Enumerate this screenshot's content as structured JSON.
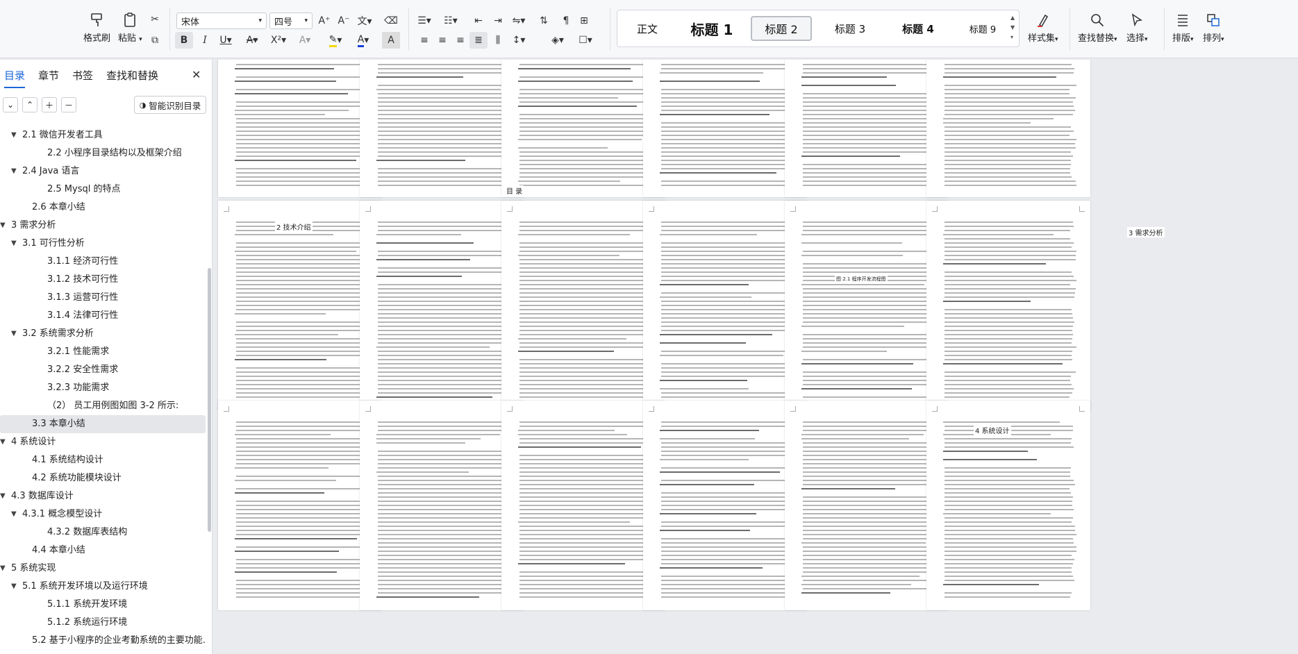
{
  "ribbon": {
    "format_painter": "格式刷",
    "paste": "粘贴",
    "font_name": "宋体",
    "font_size": "四号",
    "styles": [
      "正文",
      "标题 1",
      "标题 2",
      "标题 3",
      "标题 4",
      "标题 9"
    ],
    "style_set": "样式集",
    "find_replace": "查找替换",
    "select": "选择",
    "layout": "排版",
    "arrange": "排列"
  },
  "nav": {
    "tabs": [
      "目录",
      "章节",
      "书签",
      "查找和替换"
    ],
    "smart_toc": "智能识别目录",
    "items": [
      {
        "label": "2.1 微信开发者工具",
        "level": 2,
        "arrow": "down"
      },
      {
        "label": "2.2 小程序目录结构以及框架介绍",
        "level": 3,
        "arrow": ""
      },
      {
        "label": "2.4 Java 语言",
        "level": 2,
        "arrow": "down"
      },
      {
        "label": "2.5 Mysql 的特点",
        "level": 3,
        "arrow": ""
      },
      {
        "label": "2.6 本章小结",
        "level": 2,
        "arrow": ""
      },
      {
        "label": "3 需求分析",
        "level": 1,
        "arrow": "down"
      },
      {
        "label": "3.1 可行性分析",
        "level": 2,
        "arrow": "down"
      },
      {
        "label": "3.1.1 经济可行性",
        "level": 3,
        "arrow": ""
      },
      {
        "label": "3.1.2 技术可行性",
        "level": 3,
        "arrow": ""
      },
      {
        "label": "3.1.3 运营可行性",
        "level": 3,
        "arrow": ""
      },
      {
        "label": "3.1.4 法律可行性",
        "level": 3,
        "arrow": ""
      },
      {
        "label": "3.2 系统需求分析",
        "level": 2,
        "arrow": "down"
      },
      {
        "label": "3.2.1  性能需求",
        "level": 3,
        "arrow": ""
      },
      {
        "label": "3.2.2  安全性需求",
        "level": 3,
        "arrow": ""
      },
      {
        "label": "3.2.3 功能需求",
        "level": 3,
        "arrow": ""
      },
      {
        "label": "（2）  员工用例图如图 3-2 所示:",
        "level": 3,
        "arrow": ""
      },
      {
        "label": "3.3 本章小结",
        "level": 2,
        "arrow": "",
        "selected": true
      },
      {
        "label": "4 系统设计",
        "level": 1,
        "arrow": "down"
      },
      {
        "label": "4.1 系统结构设计",
        "level": 2,
        "arrow": ""
      },
      {
        "label": "4.2 系统功能模块设计",
        "level": 2,
        "arrow": ""
      },
      {
        "label": "4.3  数据库设计",
        "level": 1,
        "arrow": "down"
      },
      {
        "label": "4.3.1  概念模型设计",
        "level": 2,
        "arrow": "down"
      },
      {
        "label": "4.3.2  数据库表结构",
        "level": 3,
        "arrow": ""
      },
      {
        "label": "4.4 本章小结",
        "level": 2,
        "arrow": ""
      },
      {
        "label": "5  系统实现",
        "level": 1,
        "arrow": "down"
      },
      {
        "label": "5.1 系统开发环境以及运行环境",
        "level": 2,
        "arrow": "down"
      },
      {
        "label": "5.1.1  系统开发环境",
        "level": 3,
        "arrow": ""
      },
      {
        "label": "5.1.2  系统运行环境",
        "level": 3,
        "arrow": ""
      },
      {
        "label": "5.2 基于小程序的企业考勤系统的主要功能…",
        "level": 2,
        "arrow": ""
      }
    ]
  },
  "doc": {
    "page_titles": {
      "toc": "目  录",
      "ch2": "2 技术介绍",
      "ch3": "3 需求分析",
      "ch4": "4 系统设计"
    },
    "figure_caption": "图 2.1 程序开发流程图"
  }
}
